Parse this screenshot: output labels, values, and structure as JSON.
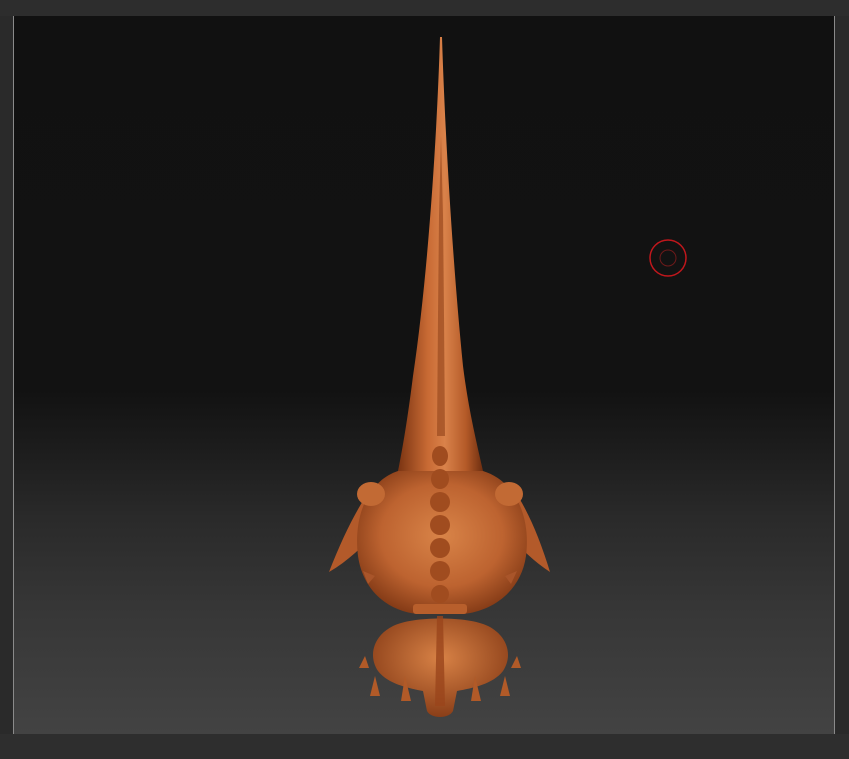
{
  "colors": {
    "clay": "#c86a34",
    "clay_dark": "#8e3f18",
    "clay_light": "#e08a4c",
    "cursor": "#c0171c",
    "canvas_top": "#111111",
    "canvas_bottom": "#434343"
  },
  "icons": {
    "brush_cursor": "brush-cursor-icon"
  }
}
